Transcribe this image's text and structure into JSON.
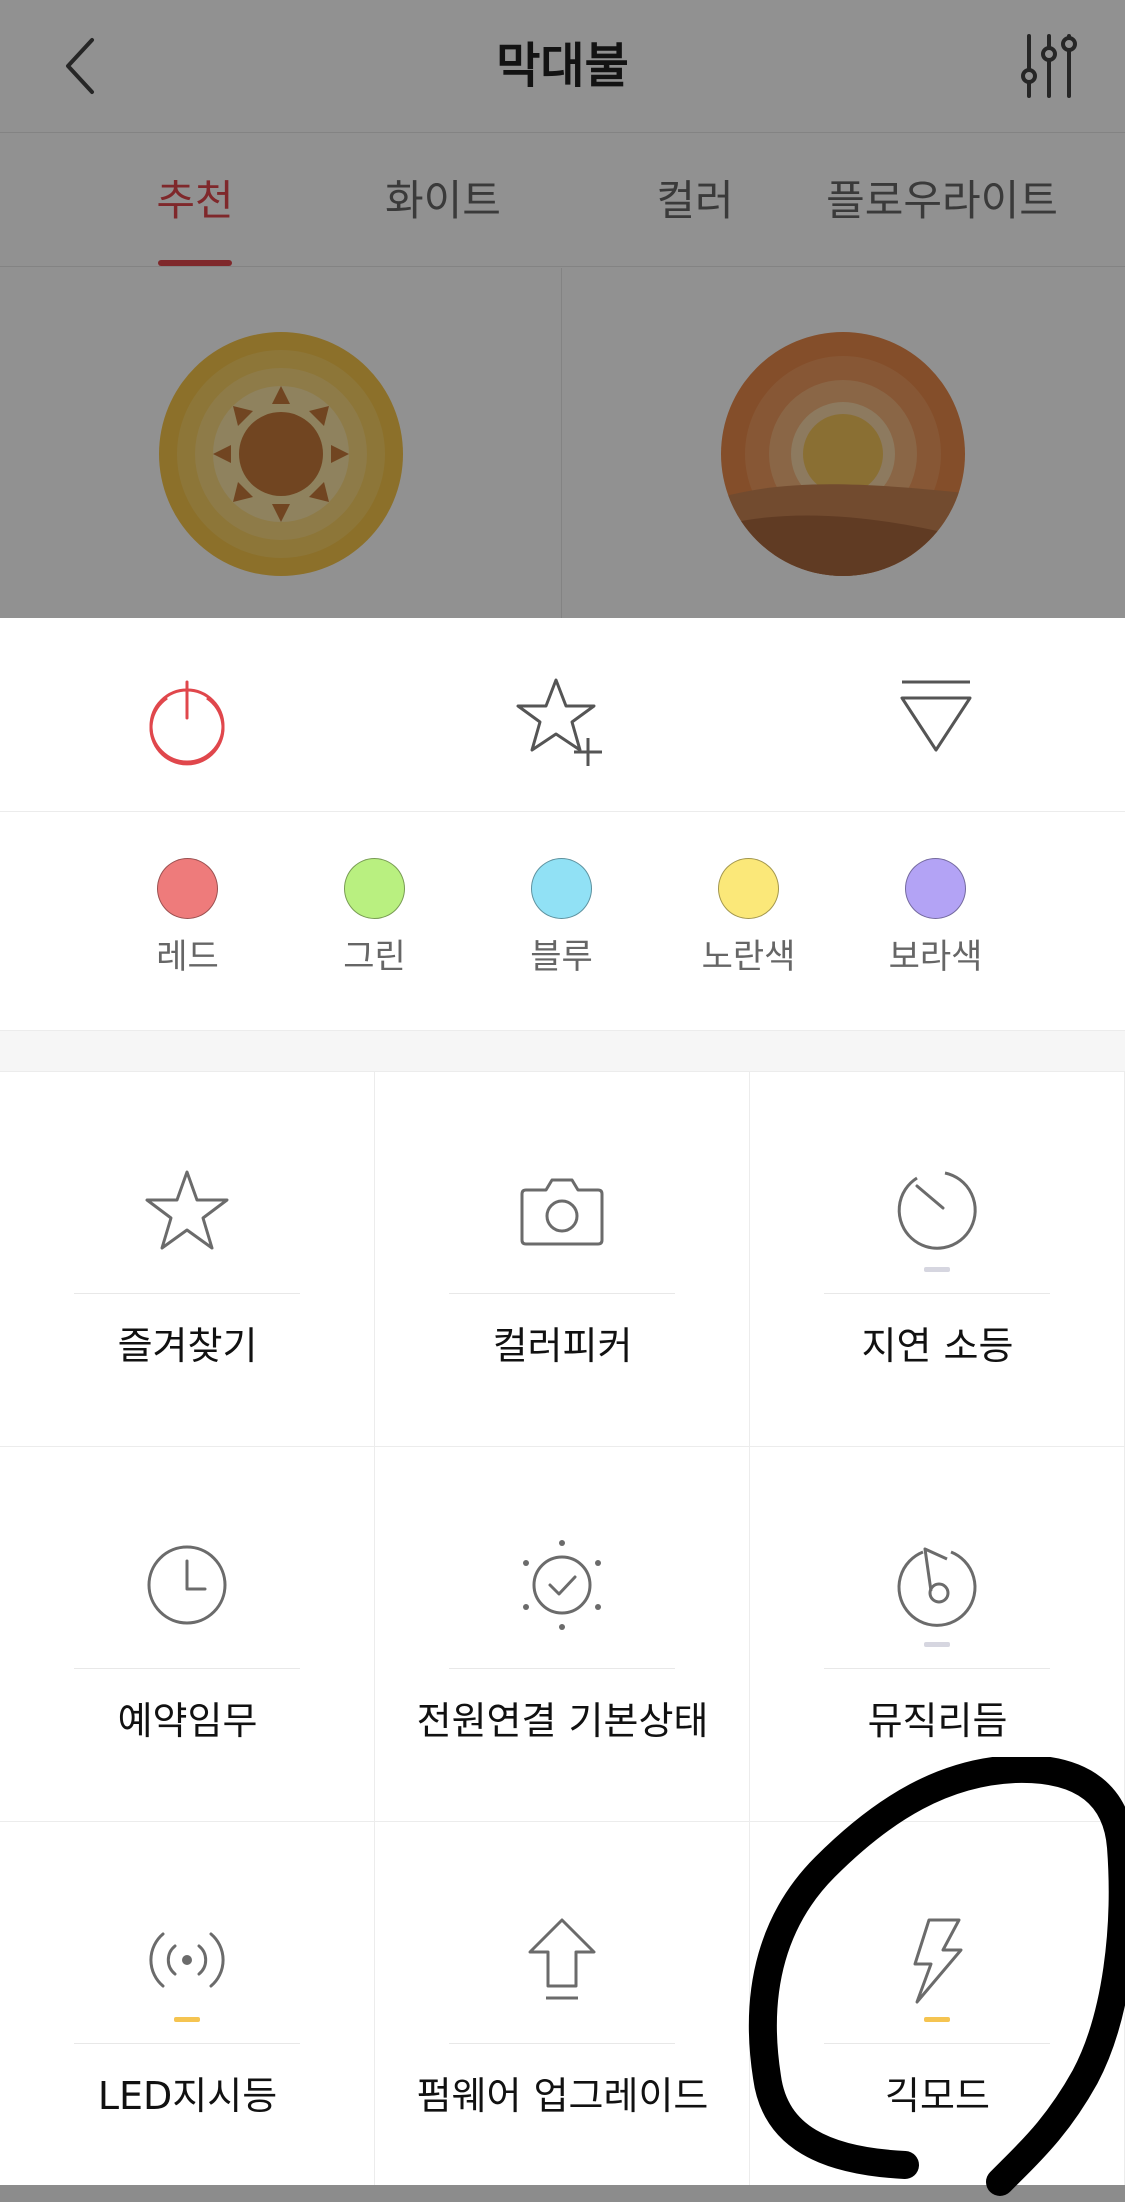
{
  "header": {
    "title": "막대불",
    "back_icon": "chevron-left-icon",
    "settings_icon": "sliders-icon"
  },
  "tabs": [
    {
      "label": "추천",
      "active": true
    },
    {
      "label": "화이트",
      "active": false
    },
    {
      "label": "컬러",
      "active": false
    },
    {
      "label": "플로우라이트",
      "active": false
    }
  ],
  "scenes": [
    {
      "icon": "sun-scene-icon"
    },
    {
      "icon": "sunset-scene-icon"
    }
  ],
  "quick_actions": [
    {
      "icon": "power-icon",
      "color": "#e0474c"
    },
    {
      "icon": "star-plus-icon"
    },
    {
      "icon": "collapse-triangle-icon"
    }
  ],
  "colors": [
    {
      "label": "레드",
      "hex": "#ee7b7b"
    },
    {
      "label": "그린",
      "hex": "#b9f080"
    },
    {
      "label": "블루",
      "hex": "#91e1f5"
    },
    {
      "label": "노란색",
      "hex": "#fbe879"
    },
    {
      "label": "보라색",
      "hex": "#b3a3f5"
    }
  ],
  "functions": [
    {
      "label": "즐겨찾기",
      "icon": "star-icon",
      "indicator": null
    },
    {
      "label": "컬러피커",
      "icon": "camera-icon",
      "indicator": null
    },
    {
      "label": "지연 소등",
      "icon": "timer-icon",
      "indicator": "#d6d6e0"
    },
    {
      "label": "예약임무",
      "icon": "clock-icon",
      "indicator": null
    },
    {
      "label": "전원연결 기본상태",
      "icon": "power-on-check-icon",
      "indicator": null
    },
    {
      "label": "뮤직리듬",
      "icon": "music-icon",
      "indicator": "#d6d6e0"
    },
    {
      "label": "LED지시등",
      "icon": "signal-icon",
      "indicator": "#f5c451"
    },
    {
      "label": "펌웨어 업그레이드",
      "icon": "upgrade-arrow-icon",
      "indicator": null
    },
    {
      "label": "긱모드",
      "icon": "lightning-icon",
      "indicator": "#f5c451"
    }
  ],
  "theme": {
    "accent": "#e0474c",
    "icon_stroke": "#6b6b6b"
  }
}
